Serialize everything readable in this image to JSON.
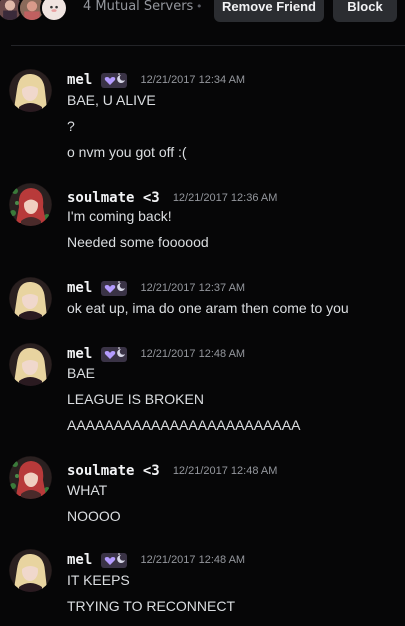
{
  "header": {
    "mutual_servers": "4 Mutual Servers",
    "separator": "•",
    "remove_friend_label": "Remove Friend",
    "block_label": "Block"
  },
  "colors": {
    "background": "#060607",
    "button_bg": "#2b2d31",
    "badge_purple": "#b49cff",
    "muted_text": "#94979d"
  },
  "messages": [
    {
      "username": "mel",
      "avatar": "blonde-avatar",
      "badge": "purple-heart-moon-badge",
      "timestamp": "12/21/2017 12:34 AM",
      "lines": [
        "BAE, U ALIVE",
        "?",
        "o nvm you got off :("
      ]
    },
    {
      "username": "soulmate <3",
      "avatar": "red-hair-avatar",
      "timestamp": "12/21/2017 12:36 AM",
      "lines": [
        "I'm coming back!",
        "Needed some foooood"
      ]
    },
    {
      "username": "mel",
      "avatar": "blonde-avatar",
      "badge": "purple-heart-moon-badge",
      "timestamp": "12/21/2017 12:37 AM",
      "lines": [
        "ok eat up, ima do one aram then come to you"
      ]
    },
    {
      "username": "mel",
      "avatar": "blonde-avatar",
      "badge": "purple-heart-moon-badge",
      "timestamp": "12/21/2017 12:48 AM",
      "lines": [
        "BAE",
        "LEAGUE IS BROKEN",
        "AAAAAAAAAAAAAAAAAAAAAAAAA"
      ]
    },
    {
      "username": "soulmate <3",
      "avatar": "red-hair-avatar",
      "timestamp": "12/21/2017 12:48 AM",
      "lines": [
        "WHAT",
        "NOOOO"
      ]
    },
    {
      "username": "mel",
      "avatar": "blonde-avatar",
      "badge": "purple-heart-moon-badge",
      "timestamp": "12/21/2017 12:48 AM",
      "lines": [
        "IT KEEPS",
        "TRYING TO RECONNECT"
      ]
    }
  ]
}
